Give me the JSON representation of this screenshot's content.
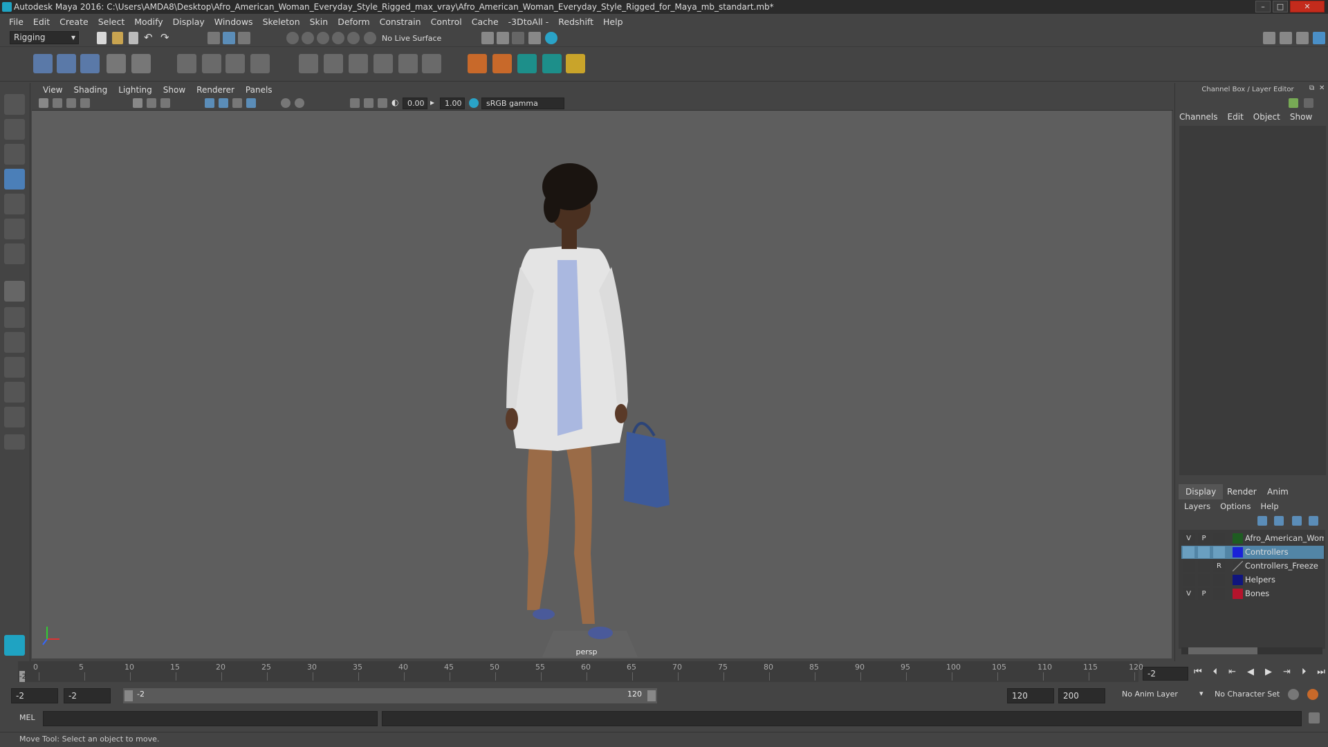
{
  "title": "Autodesk Maya 2016: C:\\Users\\AMDA8\\Desktop\\Afro_American_Woman_Everyday_Style_Rigged_max_vray\\Afro_American_Woman_Everyday_Style_Rigged_for_Maya_mb_standart.mb*",
  "menus": [
    "File",
    "Edit",
    "Create",
    "Select",
    "Modify",
    "Display",
    "Windows",
    "Skeleton",
    "Skin",
    "Deform",
    "Constrain",
    "Control",
    "Cache",
    "-3DtoAll -",
    "Redshift",
    "Help"
  ],
  "menuset": "Rigging",
  "live_surface": "No Live Surface",
  "panel_menus": [
    "View",
    "Shading",
    "Lighting",
    "Show",
    "Renderer",
    "Panels"
  ],
  "exposure": "0.00",
  "gamma": "1.00",
  "color_space": "sRGB gamma",
  "camera_label": "persp",
  "channel_box": {
    "title": "Channel Box / Layer Editor",
    "menus": [
      "Channels",
      "Edit",
      "Object",
      "Show"
    ]
  },
  "layer_editor": {
    "tabs": [
      "Display",
      "Render",
      "Anim"
    ],
    "menus": [
      "Layers",
      "Options",
      "Help"
    ],
    "layers": [
      {
        "v": "V",
        "p": "P",
        "r": "",
        "name": "Afro_American_Woman",
        "color": "#1f5c22",
        "selected": false
      },
      {
        "v": "",
        "p": "",
        "r": "",
        "name": "Controllers",
        "color": "#1a22d8",
        "selected": true
      },
      {
        "v": "",
        "p": "",
        "r": "R",
        "name": "Controllers_Freeze",
        "color": "",
        "selected": false
      },
      {
        "v": "",
        "p": "",
        "r": "",
        "name": "Helpers",
        "color": "#10157e",
        "selected": false
      },
      {
        "v": "V",
        "p": "P",
        "r": "",
        "name": "Bones",
        "color": "#b5142c",
        "selected": false
      }
    ]
  },
  "timeline": {
    "ticks": [
      "0",
      "5",
      "10",
      "15",
      "20",
      "25",
      "30",
      "35",
      "40",
      "45",
      "50",
      "55",
      "60",
      "65",
      "70",
      "75",
      "80",
      "85",
      "90",
      "95",
      "100",
      "105",
      "110",
      "115",
      "120"
    ],
    "current_frame": "-2",
    "current_marker": "-2"
  },
  "range": {
    "start": "-2",
    "playback_start": "-2",
    "slider_start": "-2",
    "slider_end": "120",
    "playback_end": "120",
    "end": "200",
    "anim_layer": "No Anim Layer",
    "character_set": "No Character Set"
  },
  "cmd_label": "MEL",
  "help_text": "Move Tool: Select an object to move."
}
